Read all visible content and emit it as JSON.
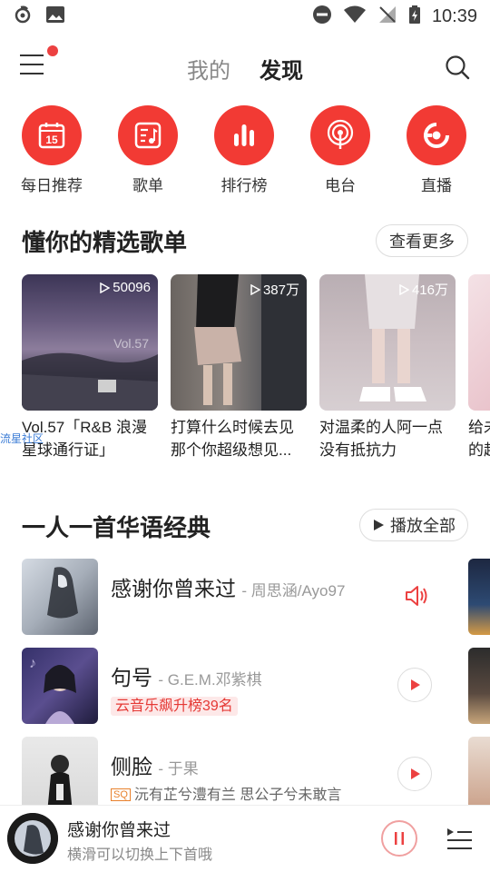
{
  "status_bar": {
    "time": "10:39"
  },
  "header": {
    "tabs": [
      {
        "label": "我的"
      },
      {
        "label": "发现"
      }
    ]
  },
  "categories": [
    {
      "label": "每日推荐",
      "icon": "calendar-icon",
      "number": "15"
    },
    {
      "label": "歌单",
      "icon": "playlist-icon"
    },
    {
      "label": "排行榜",
      "icon": "chart-icon"
    },
    {
      "label": "电台",
      "icon": "radio-icon"
    },
    {
      "label": "直播",
      "icon": "live-icon"
    }
  ],
  "playlists_section": {
    "title": "懂你的精选歌单",
    "more_label": "查看更多",
    "cards": [
      {
        "count": "50096",
        "cover_text": "Vol.57",
        "line1": "Vol.57「R&B 浪漫",
        "line2": "星球通行证」"
      },
      {
        "count": "387万",
        "line1": "打算什么时候去见",
        "line2": "那个你超级想见..."
      },
      {
        "count": "416万",
        "line1": "对温柔的人阿一点",
        "line2": "没有抵抗力"
      },
      {
        "line1": "给未",
        "line2": "的超"
      }
    ],
    "watermark": "流星社区"
  },
  "songs_section": {
    "title": "一人一首华语经典",
    "play_all_label": "播放全部",
    "songs": [
      {
        "title": "感谢你曾来过",
        "artist": "- 周思涵/Ayo97",
        "playing": true
      },
      {
        "title": "句号",
        "artist": "- G.E.M.邓紫棋",
        "badge": "云音乐飙升榜39名"
      },
      {
        "title": "侧脸",
        "artist": "- 于果",
        "quality_tag": "SQ",
        "subtitle": "沅有芷兮澧有兰 思公子兮未敢言"
      }
    ]
  },
  "player": {
    "title": "感谢你曾来过",
    "hint": "横滑可以切换上下首哦"
  },
  "colors": {
    "accent": "#f23a34",
    "badge_bg": "#fde8e8"
  }
}
